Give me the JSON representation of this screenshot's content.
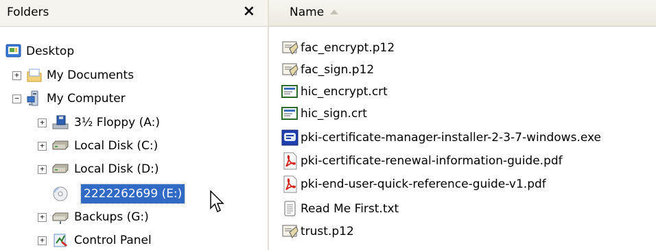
{
  "folders_pane": {
    "title": "Folders",
    "close_glyph": "×",
    "tree": [
      {
        "label": "Desktop",
        "icon": "desktop-icon",
        "expander": ""
      },
      {
        "label": "My Documents",
        "icon": "folder-icon",
        "expander": "+"
      },
      {
        "label": "My Computer",
        "icon": "computer-icon",
        "expander": "−"
      },
      {
        "label": "3½ Floppy (A:)",
        "icon": "floppy-drive-icon",
        "expander": "+"
      },
      {
        "label": "Local Disk (C:)",
        "icon": "hard-disk-icon",
        "expander": "+"
      },
      {
        "label": "Local Disk (D:)",
        "icon": "hard-disk-icon",
        "expander": "+"
      },
      {
        "label": "2222262699 (E:)",
        "icon": "cd-drive-icon",
        "expander": ""
      },
      {
        "label": "Backups (G:)",
        "icon": "network-drive-icon",
        "expander": "+"
      },
      {
        "label": "Control Panel",
        "icon": "control-panel-icon",
        "expander": "+"
      }
    ],
    "selected_item": "2222262699 (E:)"
  },
  "files_pane": {
    "column_header": "Name",
    "sort": "ascending",
    "files": [
      {
        "name": "fac_encrypt.p12",
        "icon": "certificate-package-icon"
      },
      {
        "name": "fac_sign.p12",
        "icon": "certificate-package-icon"
      },
      {
        "name": "hic_encrypt.crt",
        "icon": "certificate-icon"
      },
      {
        "name": "hic_sign.crt",
        "icon": "certificate-icon"
      },
      {
        "name": "pki-certificate-manager-installer-2-3-7-windows.exe",
        "icon": "installer-icon"
      },
      {
        "name": "pki-certificate-renewal-information-guide.pdf",
        "icon": "pdf-icon"
      },
      {
        "name": "pki-end-user-quick-reference-guide-v1.pdf",
        "icon": "pdf-icon"
      },
      {
        "name": "Read Me First.txt",
        "icon": "text-file-icon"
      },
      {
        "name": "trust.p12",
        "icon": "certificate-package-icon"
      }
    ]
  },
  "colors": {
    "selection": "#316ac5",
    "header_bg": "#f5f4ee"
  }
}
